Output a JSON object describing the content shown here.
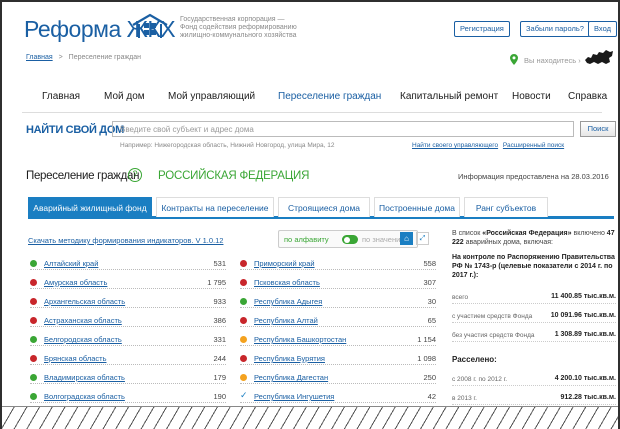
{
  "header": {
    "logo_text": "Реформа ЖКХ",
    "org_line1": "Государственная корпорация —",
    "org_line2": "Фонд содействия реформированию",
    "org_line3": "жилищно-коммунального хозяйства",
    "register_label": "Регистрация",
    "forgot_label": "Забыли пароль?",
    "login_label": "Вход",
    "location_text": "Вы находитесь",
    "breadcrumb_home": "Главная",
    "breadcrumb_sep": ">",
    "breadcrumb_current": "Переселение граждан"
  },
  "nav": [
    "Главная",
    "Мой дом",
    "Мой управляющий",
    "Переселение граждан",
    "Капитальный ремонт",
    "Новости",
    "Справка"
  ],
  "search": {
    "title": "НАЙТИ СВОЙ ДОМ",
    "placeholder": "Введите свой субъект и адрес дома",
    "button": "Поиск",
    "example": "Например: Нижегородская область, Нижний Новгород, улица Мира, 12",
    "find_manager": "Найти своего управляющего",
    "advanced": "Расширенный поиск"
  },
  "section": {
    "title": "Переселение граждан",
    "help": "?",
    "region": "РОССИЙСКАЯ ФЕДЕРАЦИЯ",
    "info_date": "Информация предоставлена на 28.03.2016"
  },
  "tabs": [
    "Аварийный жилищный фонд",
    "Контракты на переселение",
    "Строящиеся дома",
    "Построенные дома",
    "Ранг субъектов"
  ],
  "toolbar": {
    "download": "Скачать методику формирования индикаторов. V 1.0.12",
    "alpha": "по алфавиту",
    "value": "по значению",
    "home_icon": "⌂",
    "expand_icon": "⤢"
  },
  "colors": {
    "green": "#3aa635",
    "red": "#c8262b",
    "orange": "#f4a21f",
    "blue": "#1a7ec2"
  },
  "regions_left": [
    {
      "name": "Алтайский край",
      "value": "531",
      "status": "green"
    },
    {
      "name": "Амурская область",
      "value": "1 795",
      "status": "red"
    },
    {
      "name": "Архангельская область",
      "value": "933",
      "status": "red"
    },
    {
      "name": "Астраханская область",
      "value": "386",
      "status": "red"
    },
    {
      "name": "Белгородская область",
      "value": "331",
      "status": "green"
    },
    {
      "name": "Брянская область",
      "value": "244",
      "status": "red"
    },
    {
      "name": "Владимирская область",
      "value": "179",
      "status": "green"
    },
    {
      "name": "Волгоградская область",
      "value": "190",
      "status": "green"
    }
  ],
  "regions_right": [
    {
      "name": "Приморский край",
      "value": "558",
      "status": "red"
    },
    {
      "name": "Псковская область",
      "value": "307",
      "status": "red"
    },
    {
      "name": "Республика Адыгея",
      "value": "30",
      "status": "green"
    },
    {
      "name": "Республика Алтай",
      "value": "65",
      "status": "red"
    },
    {
      "name": "Республика Башкортостан",
      "value": "1 154",
      "status": "orange"
    },
    {
      "name": "Республика Бурятия",
      "value": "1 098",
      "status": "red"
    },
    {
      "name": "Республика Дагестан",
      "value": "250",
      "status": "orange"
    },
    {
      "name": "Республика Ингушетия",
      "value": "42",
      "status": "check"
    }
  ],
  "panel": {
    "list_prefix": "В список ",
    "list_bold": "«Российская Федерация»",
    "list_suffix": " включено",
    "list_count": "47 222",
    "list_tail": " аварийных дома, включая:",
    "control_title": "На контроле по Распоряжению Правительства РФ № 1743-р (целевые показатели с 2014 г. по 2017 г.):",
    "stats": [
      {
        "label": "всего",
        "value": "11 400.85 тыс.кв.м."
      },
      {
        "label": "с участием средств Фонда",
        "value": "10 091.96 тыс.кв.м."
      },
      {
        "label": "без участия средств Фонда",
        "value": "1 308.89 тыс.кв.м."
      }
    ],
    "resettled_title": "Расселено:",
    "resettled": [
      {
        "label": "с 2008 г. по 2012 г.",
        "value": "4 200.10 тыс.кв.м."
      },
      {
        "label": "в 2013 г.",
        "value": "912.28 тыс.кв.м."
      }
    ]
  }
}
